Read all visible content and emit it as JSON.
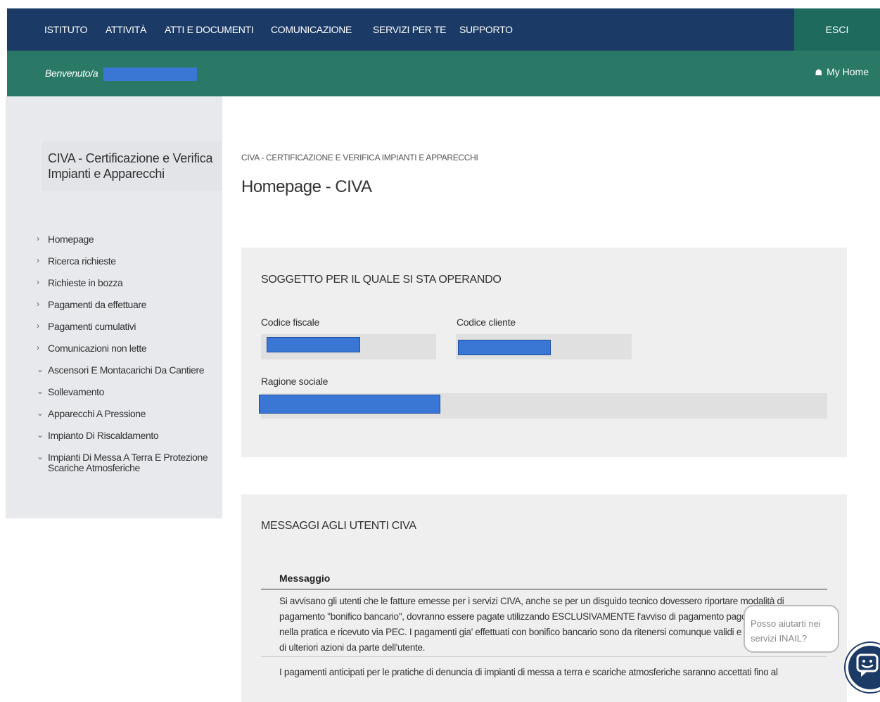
{
  "topnav": {
    "items": [
      "ISTITUTO",
      "ATTIVITÀ",
      "ATTI E DOCUMENTI",
      "COMUNICAZIONE",
      "SERVIZI PER TE",
      "SUPPORTO"
    ],
    "logout": "ESCI"
  },
  "welcome": {
    "text": "Benvenuto/a",
    "my_home": "My Home"
  },
  "sidebar": {
    "title": "CIVA - Certificazione e Verifica Impianti e Apparecchi",
    "items": [
      {
        "label": "Homepage",
        "icon": "chevron-right"
      },
      {
        "label": "Ricerca richieste",
        "icon": "chevron-right"
      },
      {
        "label": "Richieste in bozza",
        "icon": "chevron-right"
      },
      {
        "label": "Pagamenti da effettuare",
        "icon": "chevron-right"
      },
      {
        "label": "Pagamenti cumulativi",
        "icon": "chevron-right"
      },
      {
        "label": "Comunicazioni non lette",
        "icon": "chevron-right"
      },
      {
        "label": "Ascensori E Montacarichi Da Cantiere",
        "icon": "chevron-down"
      },
      {
        "label": "Sollevamento",
        "icon": "chevron-down"
      },
      {
        "label": "Apparecchi A Pressione",
        "icon": "chevron-down"
      },
      {
        "label": "Impianto Di Riscaldamento",
        "icon": "chevron-down"
      },
      {
        "label": "Impianti Di Messa A Terra E Protezione Scariche Atmosferiche",
        "icon": "chevron-down"
      }
    ]
  },
  "main": {
    "breadcrumb": "CIVA - CERTIFICAZIONE E VERIFICA IMPIANTI E APPARECCHI",
    "page_title": "Homepage - CIVA",
    "subject": {
      "title": "SOGGETTO PER IL QUALE SI STA OPERANDO",
      "codice_fiscale_label": "Codice fiscale",
      "codice_cliente_label": "Codice cliente",
      "ragione_sociale_label": "Ragione sociale"
    },
    "messages": {
      "title": "MESSAGGI AGLI UTENTI CIVA",
      "column_header": "Messaggio",
      "rows": [
        "Si avvisano gli utenti che le fatture emesse per i servizi CIVA, anche se per un disguido tecnico dovessero riportare modalità di pagamento \"bonifico bancario\", dovranno essere pagate utilizzando ESCLUSIVAMENTE l'avviso di pagamento pagoPA presente nella pratica e ricevuto via PEC. I pagamenti gia' effettuati con bonifico bancario sono da ritenersi comunque validi e non necessitano di ulteriori azioni da parte dell'utente.",
        "I pagamenti anticipati per le pratiche di denuncia di impianti di messa a terra e scariche atmosferiche saranno accettati fino al"
      ]
    }
  },
  "chat": {
    "bubble_text": "Posso aiutarti nei servizi INAIL?",
    "icon": "chat-bot-icon"
  },
  "colors": {
    "topnav_bg": "#1b3a66",
    "welcome_bg": "#2a7967",
    "logout_bg": "#1e6b5e",
    "redaction": "#3a76d3"
  }
}
